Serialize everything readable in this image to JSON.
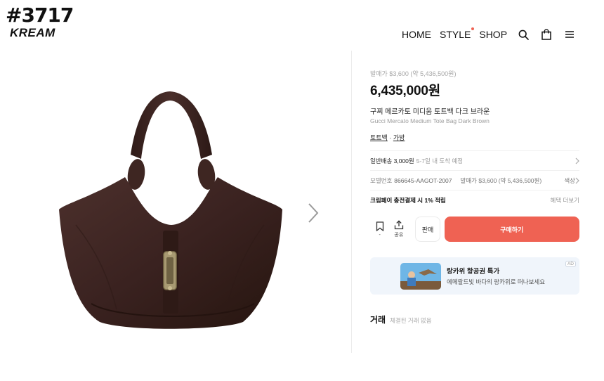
{
  "brand": {
    "id_text": "#3717",
    "logo_text": "KREAM"
  },
  "nav": {
    "items": [
      {
        "label": "HOME"
      },
      {
        "label": "STYLE"
      },
      {
        "label": "SHOP"
      }
    ],
    "icons": [
      "search-icon",
      "shopping-bag-icon",
      "menu-icon"
    ],
    "accent_color": "#ef6253"
  },
  "product": {
    "release_price": "발매가 $3,600 (약 5,436,500원)",
    "price": "6,435,000원",
    "name_ko": "구찌 메르카토 미디움 토트백 다크 브라운",
    "name_en": "Gucci Mercato Medium Tote Bag Dark Brown",
    "tag_1": "토트백",
    "tag_sep": " · ",
    "tag_2": "가방",
    "bag_color": "#3b2522"
  },
  "shipping": {
    "label": "일반배송 3,000원",
    "sub": "5-7일 내 도착 예정"
  },
  "model": {
    "label": "모델번호",
    "value": "866645-AAGOT-2007",
    "release": "발매가 $3,600 (약 5,436,500원)",
    "color_label": "색상"
  },
  "payment": {
    "label": "크림페이 충전결제 시 1% 적립",
    "more": "혜택 더보기"
  },
  "actions": {
    "bookmark_count": "-",
    "share_label": "공유",
    "sell_label": "판매",
    "buy_label": "구매하기",
    "buy_color": "#ef6253"
  },
  "ad": {
    "title": "랑카위 항공권 특가",
    "subtitle": "에메랄드빛 바다의 랑카위로 떠나보세요",
    "badge": "AD"
  },
  "trade": {
    "title": "거래",
    "subtitle": "체결된 거래 없음"
  }
}
